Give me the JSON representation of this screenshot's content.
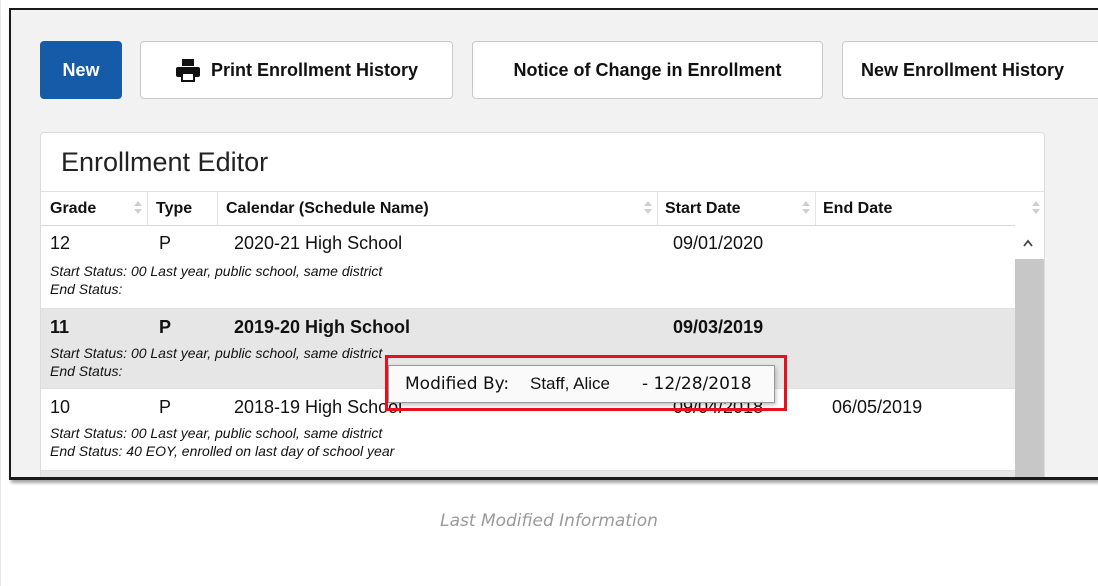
{
  "toolbar": {
    "new_label": "New",
    "print_label": "Print Enrollment History",
    "notice_label": "Notice of Change in Enrollment",
    "new_history_label": "New Enrollment History"
  },
  "editor": {
    "title": "Enrollment Editor",
    "columns": [
      "Grade",
      "Type",
      "Calendar (Schedule Name)",
      "Start Date",
      "End Date"
    ],
    "start_status_label": "Start Status:",
    "end_status_label": "End Status:",
    "rows": [
      {
        "grade": "12",
        "type": "P",
        "calendar": "2020-21 High School",
        "start_date": "09/01/2020",
        "end_date": "",
        "start_status": "00 Last year, public school, same district",
        "end_status": ""
      },
      {
        "grade": "11",
        "type": "P",
        "calendar": "2019-20 High School",
        "start_date": "09/03/2019",
        "end_date": "",
        "start_status": "00 Last year, public school, same district",
        "end_status": ""
      },
      {
        "grade": "10",
        "type": "P",
        "calendar": "2018-19 High School",
        "start_date": "09/04/2018",
        "end_date": "06/05/2019",
        "start_status": "00 Last year, public school, same district",
        "end_status": "40 EOY, enrolled on last day of school year"
      }
    ]
  },
  "tooltip": {
    "prefix": "Modified By:",
    "name": "Staff, Alice",
    "date": "- 12/28/2018"
  },
  "caption": "Last Modified Information",
  "colors": {
    "primary": "#155ba8",
    "highlight": "#e8101c",
    "selected_row": "#e6e6e6"
  }
}
